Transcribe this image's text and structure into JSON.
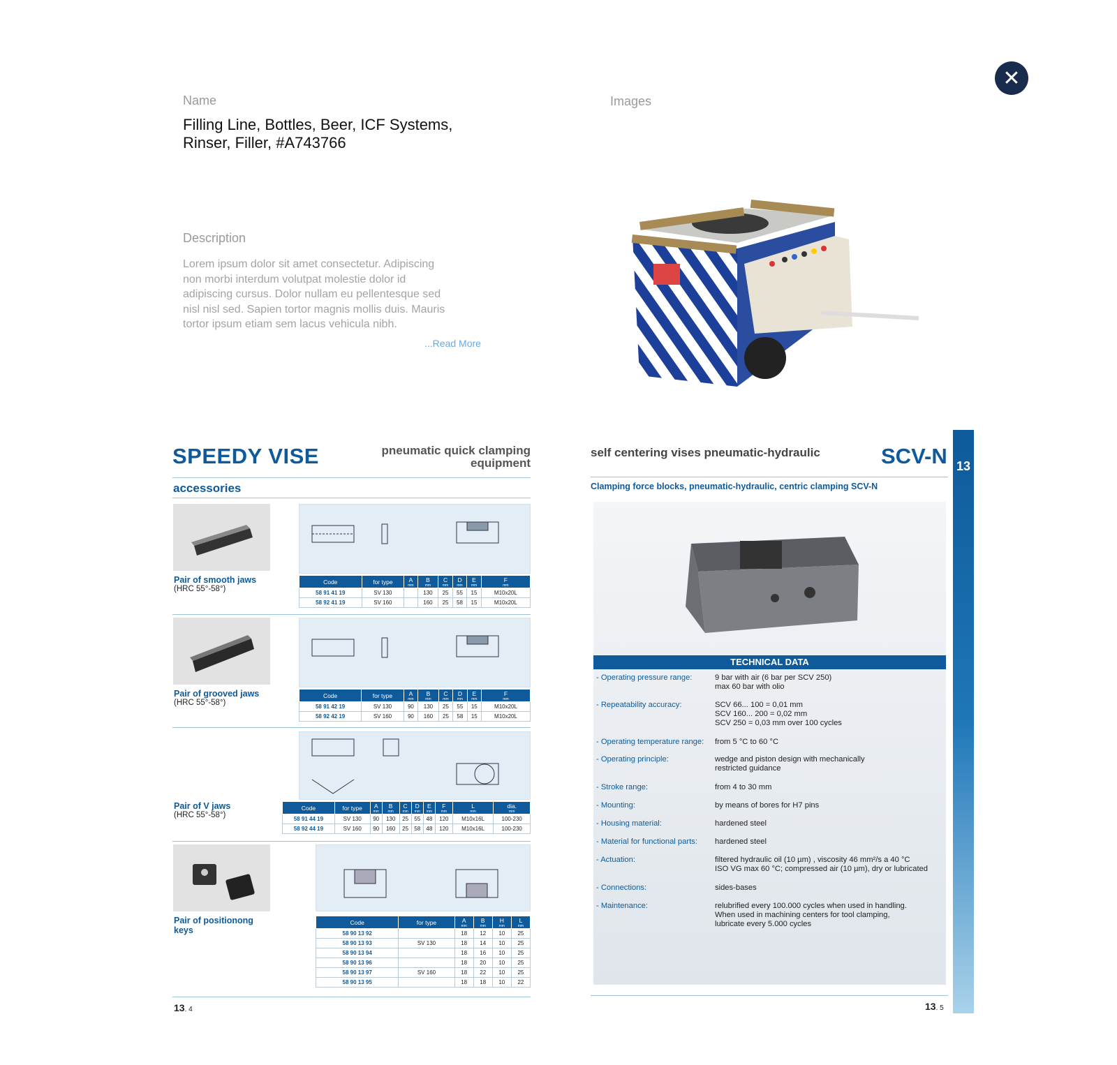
{
  "dialog": {
    "name_label": "Name",
    "images_label": "Images",
    "description_label": "Description",
    "name_value_line1": "Filling Line, Bottles, Beer, ICF Systems,",
    "name_value_line2": "Rinser, Filler, #A743766",
    "description_text": "Lorem ipsum dolor sit amet consectetur. Adipiscing non morbi interdum volutpat molestie dolor id adipiscing cursus. Dolor nullam eu pellentesque sed nisl nisl sed. Sapien tortor magnis mollis duis. Mauris tortor ipsum etiam sem lacus vehicula nibh.",
    "read_more": "...Read More",
    "close_icon": "close-icon"
  },
  "left_page": {
    "title": "SPEEDY VISE",
    "subtitle_line1": "pneumatic quick clamping",
    "subtitle_line2": "equipment",
    "section": "accessories",
    "page_num": "13",
    "page_sub": ". 4",
    "items": [
      {
        "name": "Pair of smooth jaws",
        "hrc": "(HRC 55°-58°)",
        "headers": [
          "Code",
          "for type",
          "A",
          "B",
          "C",
          "D",
          "E",
          "F"
        ],
        "units": [
          "",
          "",
          "mm",
          "mm",
          "mm",
          "mm",
          "mm",
          "mm"
        ],
        "rows": [
          [
            "58 91 41 19",
            "SV 130",
            "",
            "130",
            "25",
            "55",
            "15",
            "M10x20L"
          ],
          [
            "58 92 41 19",
            "SV 160",
            "",
            "160",
            "25",
            "58",
            "15",
            "M10x20L"
          ]
        ]
      },
      {
        "name": "Pair of grooved jaws",
        "hrc": "(HRC 55°-58°)",
        "headers": [
          "Code",
          "for type",
          "A",
          "B",
          "C",
          "D",
          "E",
          "F"
        ],
        "units": [
          "",
          "",
          "mm",
          "mm",
          "mm",
          "mm",
          "mm",
          "mm"
        ],
        "rows": [
          [
            "58 91 42 19",
            "SV 130",
            "90",
            "130",
            "25",
            "55",
            "15",
            "M10x20L"
          ],
          [
            "58 92 42 19",
            "SV 160",
            "90",
            "160",
            "25",
            "58",
            "15",
            "M10x20L"
          ]
        ]
      },
      {
        "name": "Pair of V jaws",
        "hrc": "(HRC 55°-58°)",
        "headers": [
          "Code",
          "for type",
          "A",
          "B",
          "C",
          "D",
          "E",
          "F",
          "L",
          "dia."
        ],
        "units": [
          "",
          "",
          "mm",
          "mm",
          "mm",
          "mm",
          "mm",
          "mm",
          "mm",
          "mm"
        ],
        "rows": [
          [
            "58 91 44 19",
            "SV 130",
            "90",
            "130",
            "25",
            "55",
            "48",
            "120",
            "M10x16L",
            "100-230"
          ],
          [
            "58 92 44 19",
            "SV 160",
            "90",
            "160",
            "25",
            "58",
            "48",
            "120",
            "M10x16L",
            "100-230"
          ]
        ]
      },
      {
        "name_line1": "Pair of positionong",
        "name_line2": "keys",
        "headers": [
          "Code",
          "for type",
          "A",
          "B",
          "H",
          "L"
        ],
        "units": [
          "",
          "",
          "mm",
          "mm",
          "mm",
          "mm"
        ],
        "rows": [
          [
            "58 90 13 92",
            "",
            "18",
            "12",
            "10",
            "25"
          ],
          [
            "58 90 13 93",
            "SV 130",
            "18",
            "14",
            "10",
            "25"
          ],
          [
            "58 90 13 94",
            "",
            "18",
            "16",
            "10",
            "25"
          ],
          [
            "58 90 13 96",
            "",
            "18",
            "20",
            "10",
            "25"
          ],
          [
            "58 90 13 97",
            "SV 160",
            "18",
            "22",
            "10",
            "25"
          ],
          [
            "58 90 13 95",
            "",
            "18",
            "18",
            "10",
            "22"
          ]
        ]
      }
    ]
  },
  "right_page": {
    "title_text": "self centering vises pneumatic-hydraulic",
    "product": "SCV-N",
    "tab_num": "13",
    "subtitle": "Clamping force blocks, pneumatic-hydraulic, centric clamping SCV-N",
    "tech_header": "TECHNICAL DATA",
    "page_num": "13",
    "page_sub": ". 5",
    "tech": [
      {
        "k": "- Operating pressure range:",
        "v1": "9 bar with air (6 bar per SCV 250)",
        "v2": "max 60 bar with olio"
      },
      {
        "k": "- Repeatability accuracy:",
        "v1": "SCV 66... 100      = 0,01 mm",
        "v2": "SCV 160... 200    = 0,02 mm",
        "v3": "SCV 250                = 0,03 mm over 100 cycles"
      },
      {
        "k": "- Operating temperature range:",
        "v1": "from 5 °C to 60 °C"
      },
      {
        "k": "- Operating principle:",
        "v1": "wedge and piston design with mechanically",
        "v2": "restricted guidance"
      },
      {
        "k": "- Stroke range:",
        "v1": "from 4 to 30 mm"
      },
      {
        "k": "- Mounting:",
        "v1": "by means of bores for H7 pins"
      },
      {
        "k": "- Housing material:",
        "v1": "hardened steel"
      },
      {
        "k": "- Material for functional parts:",
        "v1": "hardened steel"
      },
      {
        "k": "- Actuation:",
        "v1": "filtered hydraulic oil (10 µm) , viscosity 46 mm²/s a 40 °C",
        "v2": "ISO VG max 60 °C; compressed air (10 µm), dry or lubricated"
      },
      {
        "k": "- Connections:",
        "v1": "sides-bases"
      },
      {
        "k": "- Maintenance:",
        "v1": "relubrified every 100.000 cycles when used in handling.",
        "v2": "When used in machining centers for tool clamping,",
        "v3": "lubricate every 5.000 cycles"
      }
    ]
  }
}
